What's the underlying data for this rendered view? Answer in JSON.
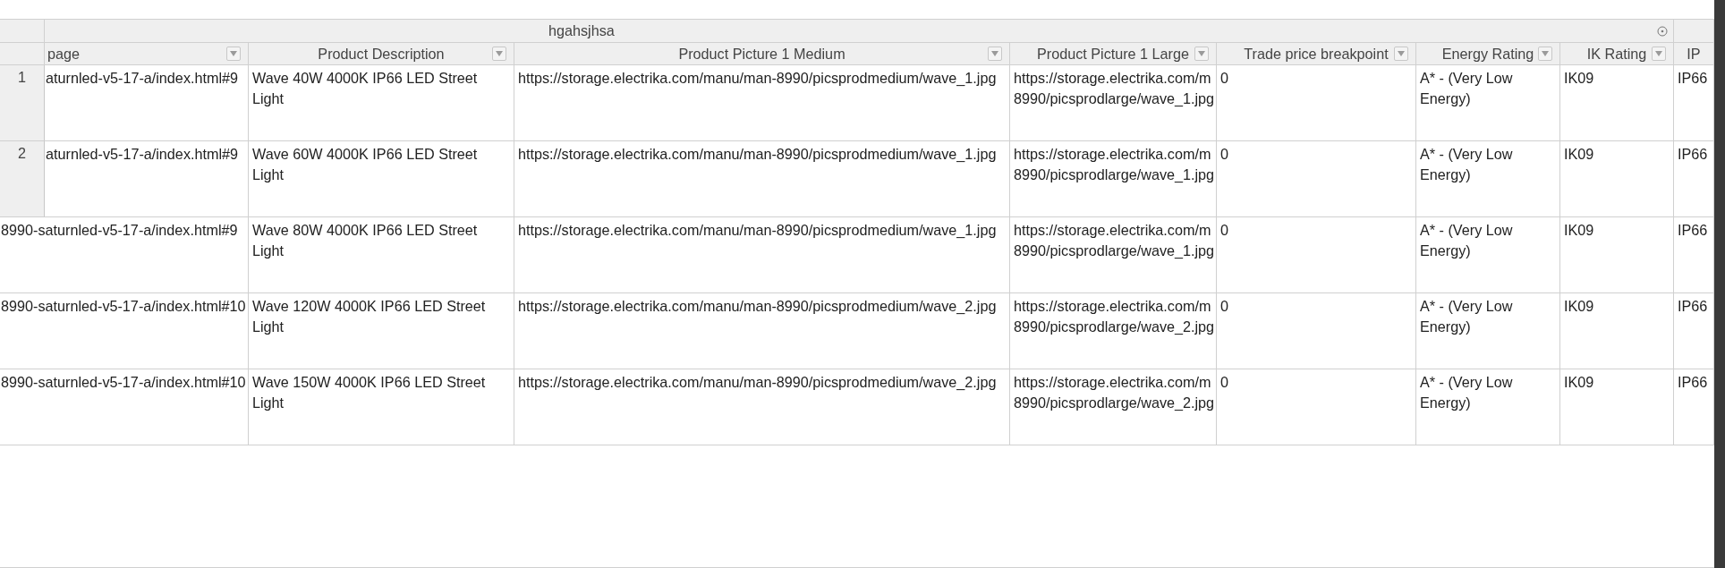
{
  "group_header": {
    "title": "hgahsjhsa"
  },
  "columns": [
    {
      "label": "page",
      "filter": true
    },
    {
      "label": "Product Description",
      "filter": true
    },
    {
      "label": "Product Picture 1 Medium",
      "filter": true
    },
    {
      "label": "Product Picture 1 Large",
      "filter": true
    },
    {
      "label": "Trade price breakpoint",
      "filter": true
    },
    {
      "label": "Energy Rating",
      "filter": true
    },
    {
      "label": "IK Rating",
      "filter": true
    },
    {
      "label": "IP",
      "filter": false
    }
  ],
  "rows": [
    {
      "number": "1",
      "cells": [
        "aturnled-v5-17-a/index.html#9",
        "Wave 40W 4000K IP66 LED Street Light",
        "https://storage.electrika.com/manu/man-8990/picsprodmedium/wave_1.jpg",
        "https://storage.electrika.com/m\n8990/picsprodlarge/wave_1.jpg",
        "0",
        "A* - (Very Low Energy)",
        "IK09",
        "IP66"
      ]
    },
    {
      "number": "2",
      "cells": [
        "aturnled-v5-17-a/index.html#9",
        "Wave 60W 4000K IP66 LED Street Light",
        "https://storage.electrika.com/manu/man-8990/picsprodmedium/wave_1.jpg",
        "https://storage.electrika.com/m\n8990/picsprodlarge/wave_1.jpg",
        "0",
        "A* - (Very Low Energy)",
        "IK09",
        "IP66"
      ]
    },
    {
      "cells": [
        "8990-saturnled-v5-17-a/index.html#9",
        "Wave 80W 4000K IP66 LED Street Light",
        "https://storage.electrika.com/manu/man-8990/picsprodmedium/wave_1.jpg",
        "https://storage.electrika.com/m\n8990/picsprodlarge/wave_1.jpg",
        "0",
        "A* - (Very Low Energy)",
        "IK09",
        "IP66"
      ]
    },
    {
      "cells": [
        "8990-saturnled-v5-17-a/index.html#10",
        "Wave 120W 4000K IP66 LED Street Light",
        "https://storage.electrika.com/manu/man-8990/picsprodmedium/wave_2.jpg",
        "https://storage.electrika.com/m\n8990/picsprodlarge/wave_2.jpg",
        "0",
        "A* - (Very Low Energy)",
        "IK09",
        "IP66"
      ]
    },
    {
      "cells": [
        "8990-saturnled-v5-17-a/index.html#10",
        "Wave 150W 4000K IP66 LED Street Light",
        "https://storage.electrika.com/manu/man-8990/picsprodmedium/wave_2.jpg",
        "https://storage.electrika.com/m\n8990/picsprodlarge/wave_2.jpg",
        "0",
        "A* - (Very Low Energy)",
        "IK09",
        "IP66"
      ]
    }
  ]
}
